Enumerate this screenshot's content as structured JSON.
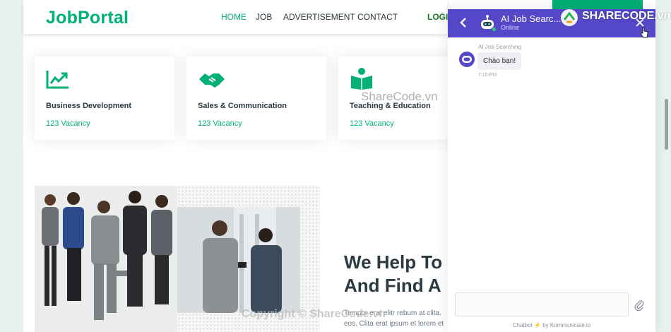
{
  "navbar": {
    "logo": "JobPortal",
    "items": [
      "HOME",
      "JOB",
      "ADVERTISEMENT",
      "CONTACT"
    ],
    "login": "LOGIN"
  },
  "categories": [
    {
      "title": "Business Development",
      "vacancy": "123 Vacancy",
      "icon": "chart-line-icon"
    },
    {
      "title": "Sales & Communication",
      "vacancy": "123 Vacancy",
      "icon": "handshake-icon"
    },
    {
      "title": "Teaching & Education",
      "vacancy": "123 Vacancy",
      "icon": "reader-icon"
    }
  ],
  "about": {
    "heading_line1": "We Help To",
    "heading_line2": "And Find A",
    "paragraph_line1": "Tempor erat elitr rebum at clita.",
    "paragraph_line2": "eos. Clita erat ipsum et lorem et"
  },
  "chat": {
    "title": "AI Job Searc...",
    "status": "Online",
    "bot_name": "AI Job Searching",
    "message": "Chào bạn!",
    "time": "7:15 PM",
    "powered_prefix": "Chatbot",
    "powered_suffix": "by Kommunicate.io"
  },
  "watermark": {
    "brand": "SHARECODE.vn",
    "center": "ShareCode.vn",
    "bottom": "Copyright © ShareCode.vn"
  },
  "colors": {
    "primary": "#00b074",
    "chat_header": "#5448c8",
    "text_dark": "#2b3940"
  }
}
